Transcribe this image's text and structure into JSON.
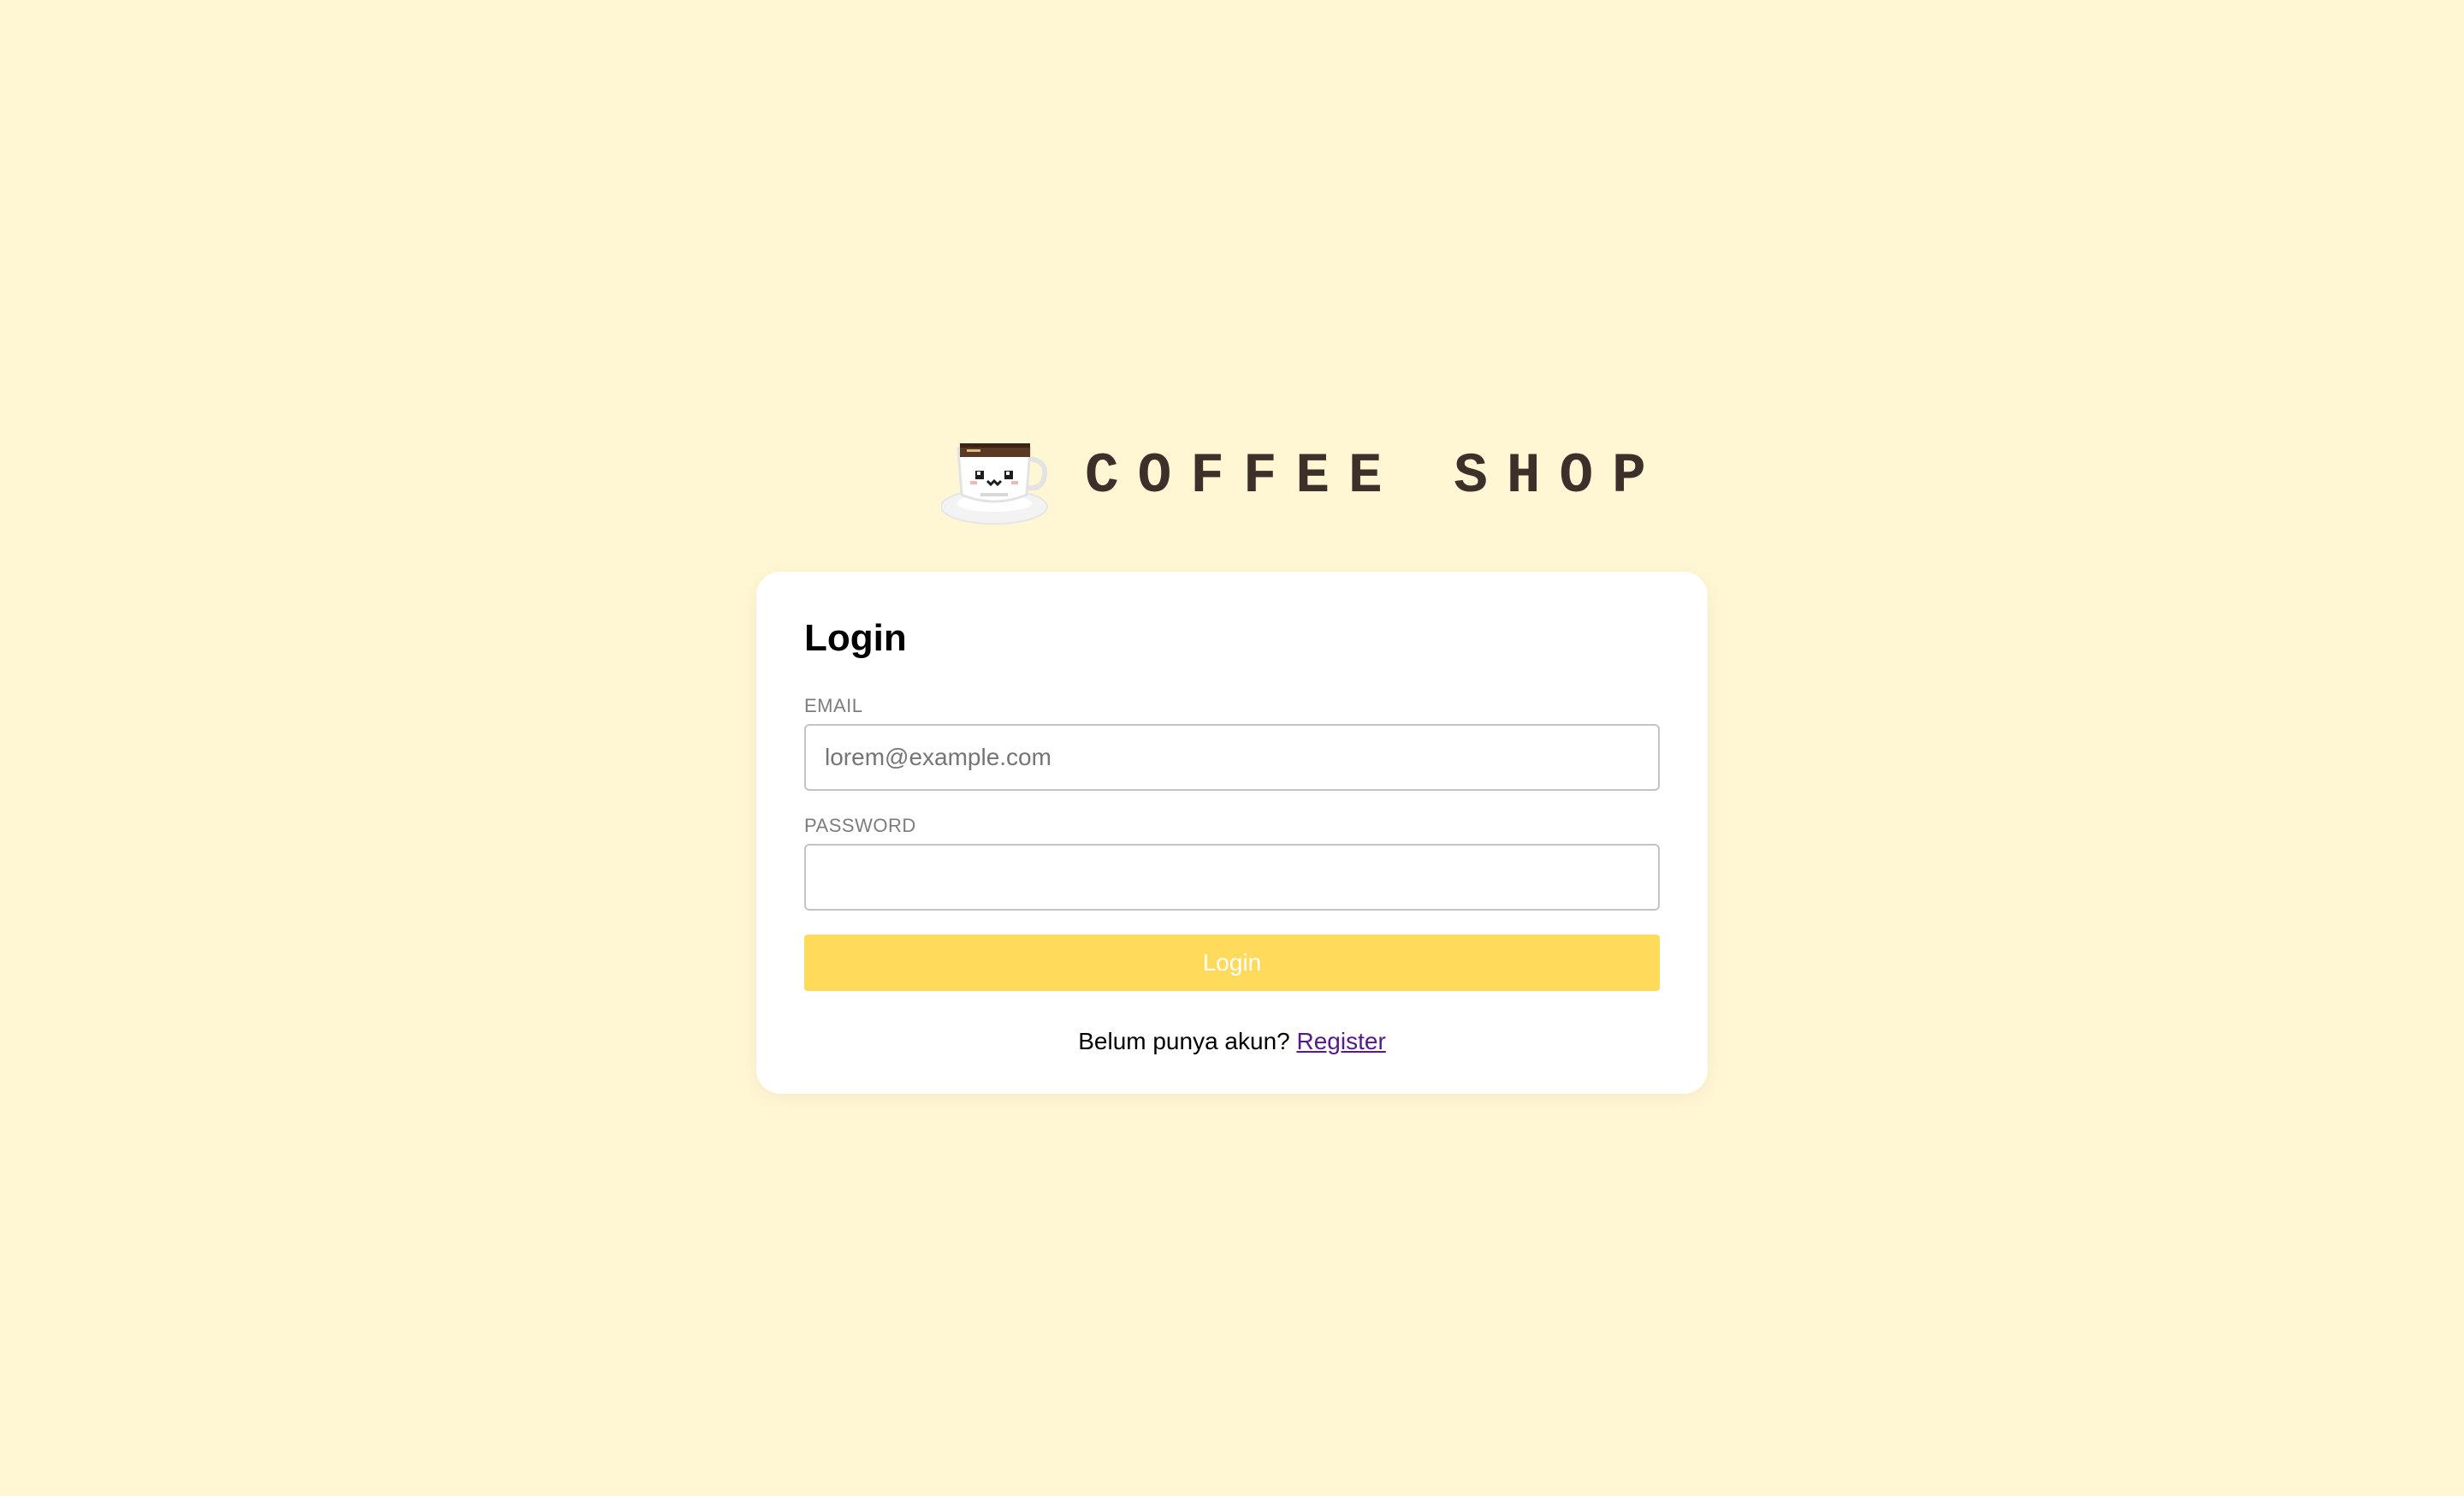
{
  "brand": {
    "title": "COFFEE SHOP",
    "icon": "coffee-cup-icon"
  },
  "login": {
    "title": "Login",
    "email": {
      "label": "EMAIL",
      "placeholder": "lorem@example.com",
      "value": ""
    },
    "password": {
      "label": "PASSWORD",
      "value": ""
    },
    "submit_label": "Login",
    "register_prompt": "Belum punya akun?",
    "register_link": "Register"
  },
  "colors": {
    "background": "#FFF6D4",
    "card": "#FFFFFF",
    "button": "#FFDA5B",
    "brand_text": "#3D302A",
    "link": "#551A8B"
  }
}
